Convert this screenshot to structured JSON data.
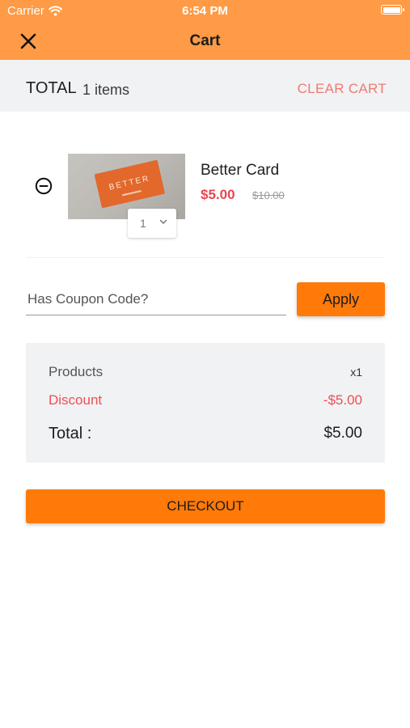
{
  "status_bar": {
    "carrier": "Carrier",
    "time": "6:54 PM",
    "battery_level": 1.0
  },
  "header": {
    "title": "Cart",
    "close_icon": "close-icon"
  },
  "summary": {
    "total_label": "TOTAL",
    "items_count": "1 items",
    "clear_cart_label": "CLEAR CART"
  },
  "cart_items": [
    {
      "name": "Better Card",
      "price": "$5.00",
      "original_price": "$10.00",
      "quantity": "1",
      "image_text": "BETTER",
      "remove_icon": "minus-circle-icon"
    }
  ],
  "coupon": {
    "placeholder": "Has Coupon Code?",
    "value": "",
    "apply_label": "Apply"
  },
  "totals": {
    "products_label": "Products",
    "products_value": "x1",
    "discount_label": "Discount",
    "discount_value": "-$5.00",
    "total_label": "Total :",
    "total_value": "$5.00"
  },
  "checkout_label": "CHECKOUT",
  "colors": {
    "header": "#ff9a46",
    "accent": "#ff7a09",
    "price_red": "#e9464f",
    "panel_gray": "#f1f2f3"
  }
}
